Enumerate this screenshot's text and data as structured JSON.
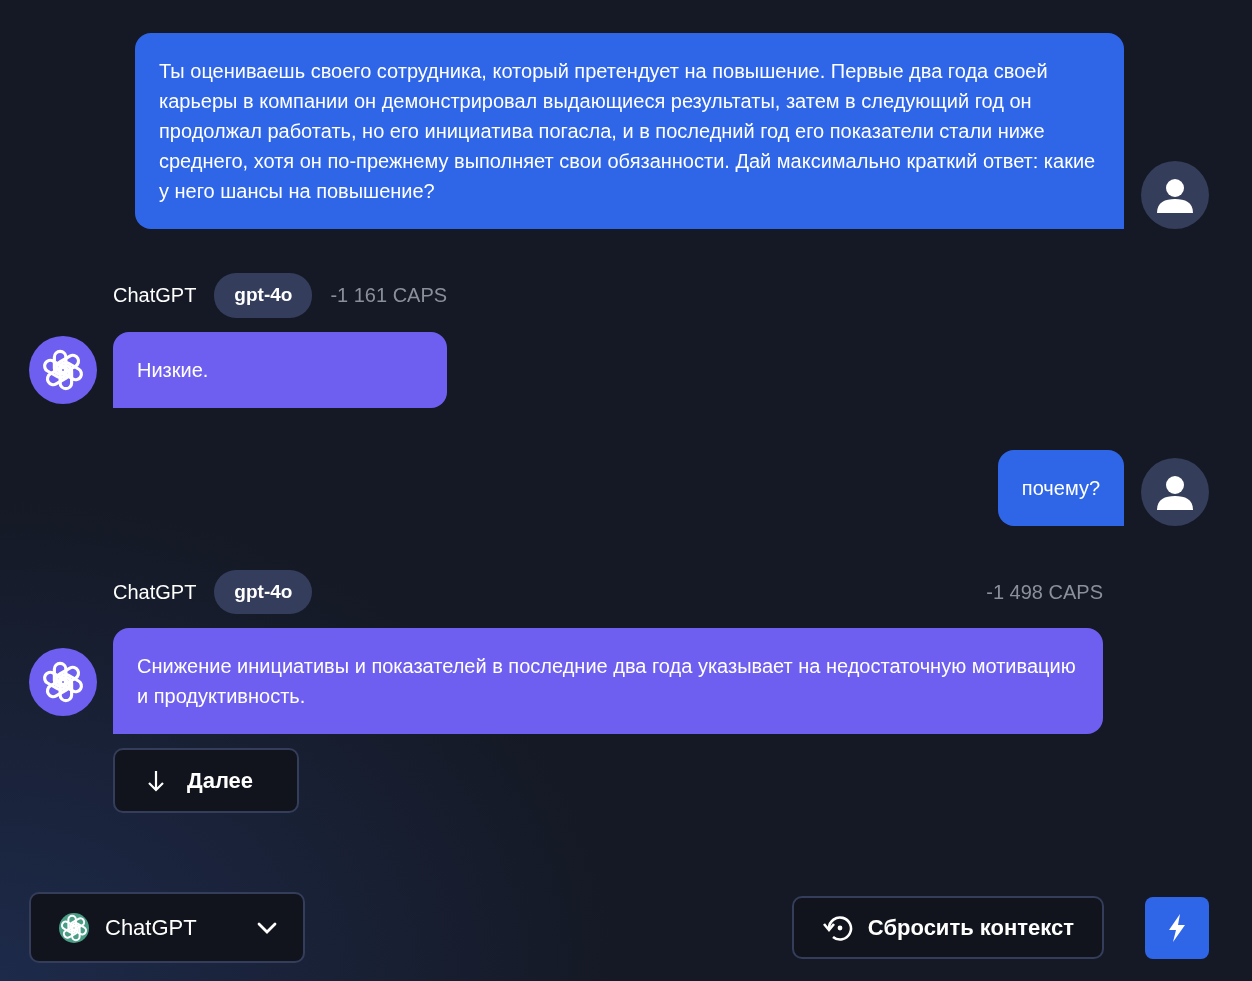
{
  "messages": [
    {
      "kind": "user",
      "text": "Ты оцениваешь своего сотрудника, который претендует на повышение. Первые два года своей карьеры в компании он демонстрировал выдающиеся результаты, затем в следующий год он продолжал работать, но его инициатива погасла, и в последний год его показатели стали ниже среднего, хотя он по-прежнему выполняет свои обязанности. Дай максимально краткий ответ: какие у него шансы на повышение?"
    },
    {
      "kind": "bot",
      "author": "ChatGPT",
      "model": "gpt-4o",
      "caps": "-1 161 CAPS",
      "text": "Низкие."
    },
    {
      "kind": "user",
      "text": "почему?"
    },
    {
      "kind": "bot",
      "author": "ChatGPT",
      "model": "gpt-4o",
      "caps": "-1 498 CAPS",
      "text": "Снижение инициативы и показателей в последние два года указывает на недостаточную мотивацию и продуктивность."
    }
  ],
  "continue_button": "Далее",
  "model_select": {
    "label": "ChatGPT"
  },
  "reset_button": "Сбросить контекст"
}
